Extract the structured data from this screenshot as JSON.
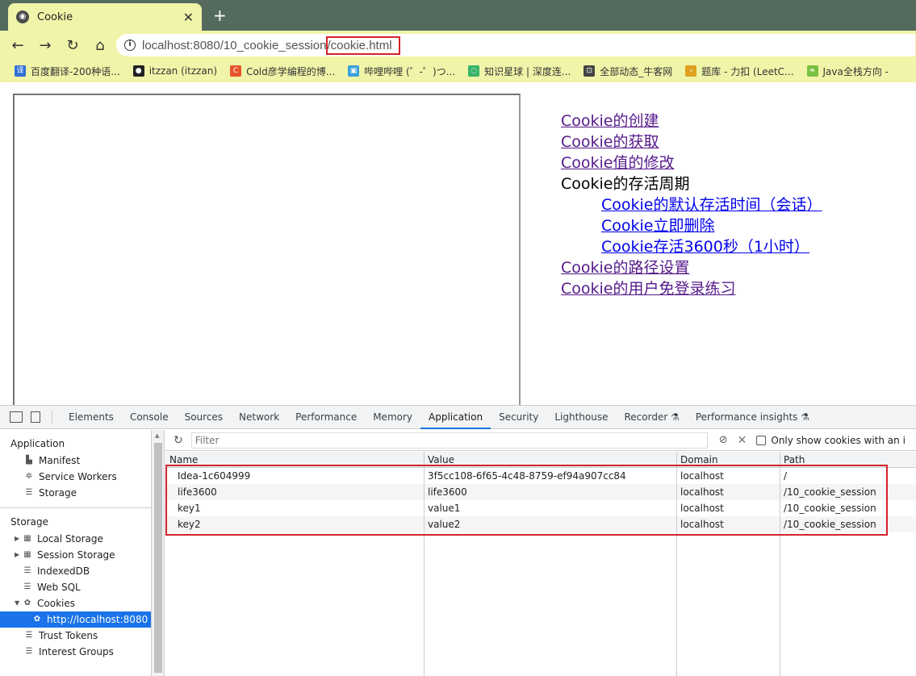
{
  "browser": {
    "tab_title": "Cookie",
    "url_host": "localhost:8080/10_cookie_session",
    "url_file": "/cookie.html",
    "bookmarks": [
      {
        "label": "百度翻译-200种语...",
        "icon": "baidu-translate-icon",
        "color": "#2f6fd6"
      },
      {
        "label": "itzzan (itzzan)",
        "icon": "github-icon",
        "color": "#222222"
      },
      {
        "label": "Cold彦学编程的博...",
        "icon": "csdn-icon",
        "color": "#e8542a"
      },
      {
        "label": "哔哩哔哩 (゜-゜)つ...",
        "icon": "bilibili-icon",
        "color": "#3aa0dc"
      },
      {
        "label": "知识星球 | 深度连...",
        "icon": "zsxq-icon",
        "color": "#37b36a"
      },
      {
        "label": "全部动态_牛客网",
        "icon": "nowcoder-icon",
        "color": "#444444"
      },
      {
        "label": "题库 - 力扣 (LeetC...",
        "icon": "leetcode-icon",
        "color": "#e0a020"
      },
      {
        "label": "Java全栈方向 -",
        "icon": "leaf-icon",
        "color": "#7ac142"
      }
    ]
  },
  "page": {
    "links": [
      {
        "text": "Cookie的创建",
        "kind": "link",
        "indent": false
      },
      {
        "text": "Cookie的获取",
        "kind": "link",
        "indent": false
      },
      {
        "text": "Cookie值的修改",
        "kind": "link",
        "indent": false
      },
      {
        "text": "Cookie的存活周期",
        "kind": "plain",
        "indent": false
      },
      {
        "text": "Cookie的默认存活时间（会话）",
        "kind": "link-blue",
        "indent": true
      },
      {
        "text": "Cookie立即删除",
        "kind": "link-blue",
        "indent": true
      },
      {
        "text": "Cookie存活3600秒（1小时）",
        "kind": "link-blue",
        "indent": true
      },
      {
        "text": "Cookie的路径设置",
        "kind": "link",
        "indent": false
      },
      {
        "text": "Cookie的用户免登录练习",
        "kind": "link",
        "indent": false
      }
    ]
  },
  "devtools": {
    "tabs": [
      "Elements",
      "Console",
      "Sources",
      "Network",
      "Performance",
      "Memory",
      "Application",
      "Security",
      "Lighthouse",
      "Recorder ⚗",
      "Performance insights ⚗"
    ],
    "active_tab": "Application",
    "sidebar": {
      "application_header": "Application",
      "application_items": [
        {
          "label": "Manifest",
          "icon": "document-icon"
        },
        {
          "label": "Service Workers",
          "icon": "gear-icon"
        },
        {
          "label": "Storage",
          "icon": "database-icon"
        }
      ],
      "storage_header": "Storage",
      "storage_items": [
        {
          "label": "Local Storage",
          "icon": "grid-icon",
          "expandable": true
        },
        {
          "label": "Session Storage",
          "icon": "grid-icon",
          "expandable": true
        },
        {
          "label": "IndexedDB",
          "icon": "database-icon",
          "expandable": false
        },
        {
          "label": "Web SQL",
          "icon": "database-icon",
          "expandable": false
        },
        {
          "label": "Cookies",
          "icon": "cookie-icon",
          "expandable": true,
          "expanded": true
        }
      ],
      "cookie_origin": "http://localhost:8080",
      "other_items": [
        {
          "label": "Trust Tokens",
          "icon": "database-icon"
        },
        {
          "label": "Interest Groups",
          "icon": "database-icon"
        }
      ]
    },
    "filter": {
      "placeholder": "Filter",
      "only_show_label": "Only show cookies with an i"
    },
    "columns": [
      "Name",
      "Value",
      "Domain",
      "Path"
    ],
    "cookies": [
      {
        "name": "Idea-1c604999",
        "value": "3f5cc108-6f65-4c48-8759-ef94a907cc84",
        "domain": "localhost",
        "path": "/"
      },
      {
        "name": "life3600",
        "value": "life3600",
        "domain": "localhost",
        "path": "/10_cookie_session"
      },
      {
        "name": "key1",
        "value": "value1",
        "domain": "localhost",
        "path": "/10_cookie_session"
      },
      {
        "name": "key2",
        "value": "value2",
        "domain": "localhost",
        "path": "/10_cookie_session"
      }
    ]
  }
}
